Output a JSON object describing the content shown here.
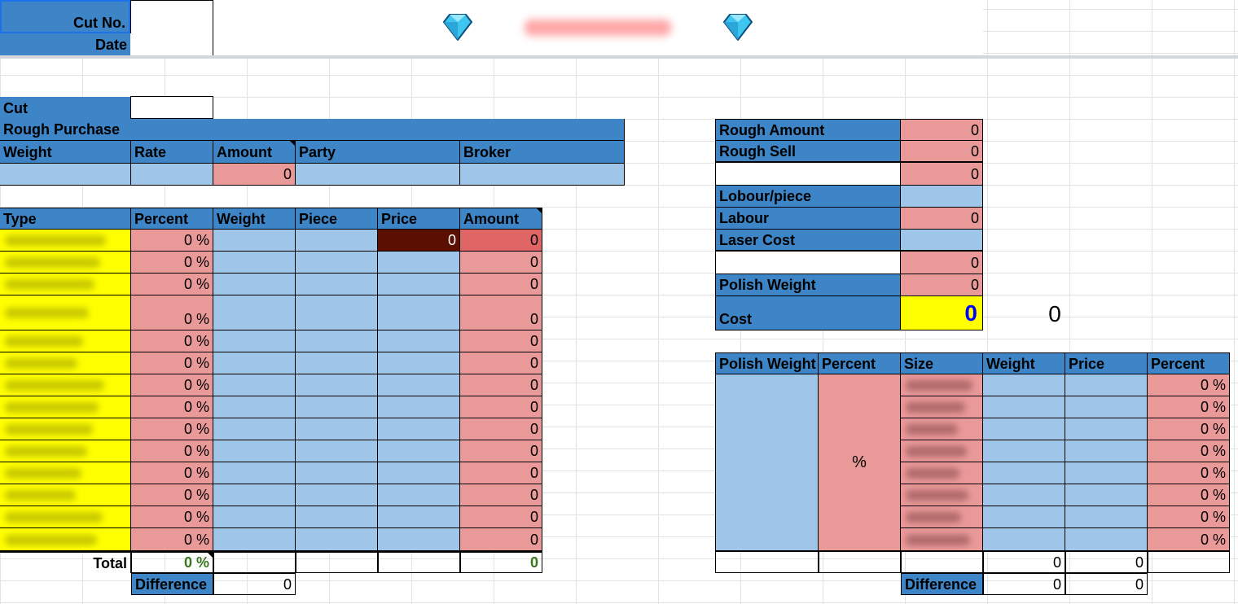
{
  "header": {
    "cut_no_label": "Cut No.",
    "date_label": "Date",
    "gem_left_icon": "diamond-icon",
    "gem_right_icon": "diamond-icon"
  },
  "colors": {
    "header_blue": "#3d85c6",
    "light_blue": "#9fc5e8",
    "pink": "#ea9999",
    "yellow": "#ffff00",
    "dark_red": "#5b0f00",
    "red": "#e06666",
    "green": "#38761d",
    "cost_blue": "#0000ff"
  },
  "rough_purchase": {
    "cut_label": "Cut",
    "title": "Rough Purchase",
    "columns": [
      "Weight",
      "Rate",
      "Amount",
      "Party",
      "Broker"
    ],
    "amount_value": "0"
  },
  "type_table": {
    "columns": [
      "Type",
      "Percent",
      "Weight",
      "Piece",
      "Price",
      "Amount"
    ],
    "rows": [
      {
        "percent": "0 %",
        "price": "0",
        "amount": "0"
      },
      {
        "percent": "0 %",
        "price": "",
        "amount": "0"
      },
      {
        "percent": "0 %",
        "price": "",
        "amount": "0"
      },
      {
        "percent": "0 %",
        "price": "",
        "amount": "0"
      },
      {
        "percent": "0 %",
        "price": "",
        "amount": "0"
      },
      {
        "percent": "0 %",
        "price": "",
        "amount": "0"
      },
      {
        "percent": "0 %",
        "price": "",
        "amount": "0"
      },
      {
        "percent": "0 %",
        "price": "",
        "amount": "0"
      },
      {
        "percent": "0 %",
        "price": "",
        "amount": "0"
      },
      {
        "percent": "0 %",
        "price": "",
        "amount": "0"
      },
      {
        "percent": "0 %",
        "price": "",
        "amount": "0"
      },
      {
        "percent": "0 %",
        "price": "",
        "amount": "0"
      },
      {
        "percent": "0 %",
        "price": "",
        "amount": "0"
      },
      {
        "percent": "0 %",
        "price": "",
        "amount": "0"
      }
    ],
    "total_label": "Total",
    "total_percent": "0 %",
    "total_amount": "0",
    "difference_label": "Difference",
    "difference_value": "0"
  },
  "summary": {
    "rough_amount_label": "Rough Amount",
    "rough_amount_value": "0",
    "rough_sell_label": "Rough Sell",
    "rough_sell_value": "0",
    "blank_value": "0",
    "labour_piece_label": "Lobour/piece",
    "labour_label": "Labour",
    "labour_value": "0",
    "laser_cost_label": "Laser Cost",
    "blank2_value": "0",
    "polish_weight_label": "Polish Weight",
    "polish_weight_value": "0",
    "cost_label": "Cost",
    "cost_value": "0",
    "cost_side_value": "0"
  },
  "polish_table": {
    "columns": [
      "Polish Weight",
      "Percent",
      "Size",
      "Weight",
      "Price",
      "Percent"
    ],
    "percent_symbol": "%",
    "rows": [
      "0 %",
      "0 %",
      "0 %",
      "0 %",
      "0 %",
      "0 %",
      "0 %",
      "0 %"
    ],
    "total_weight": "0",
    "total_price": "0",
    "difference_label": "Difference",
    "difference_weight": "0",
    "difference_price": "0"
  }
}
